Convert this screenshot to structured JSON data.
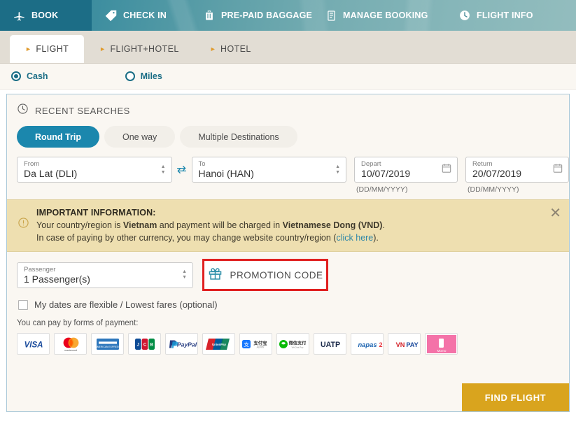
{
  "topnav": {
    "items": [
      {
        "label": "BOOK",
        "icon": "airplane-icon",
        "active": true
      },
      {
        "label": "CHECK IN",
        "icon": "boarding-pass-icon",
        "active": false
      },
      {
        "label": "PRE-PAID BAGGAGE",
        "icon": "suitcase-icon",
        "active": false
      },
      {
        "label": "MANAGE BOOKING",
        "icon": "document-icon",
        "active": false
      },
      {
        "label": "FLIGHT INFO",
        "icon": "clock-icon",
        "active": false
      }
    ]
  },
  "tabs": [
    {
      "label": "FLIGHT",
      "active": true
    },
    {
      "label": "FLIGHT+HOTEL",
      "active": false
    },
    {
      "label": "HOTEL",
      "active": false
    }
  ],
  "fare": {
    "options": [
      {
        "label": "Cash",
        "selected": true
      },
      {
        "label": "Miles",
        "selected": false
      }
    ]
  },
  "search": {
    "recent_searches_label": "RECENT SEARCHES",
    "trip_types": [
      {
        "label": "Round Trip",
        "active": true
      },
      {
        "label": "One way",
        "active": false
      },
      {
        "label": "Multiple Destinations",
        "active": false
      }
    ],
    "from": {
      "label": "From",
      "value": "Da Lat (DLI)"
    },
    "to": {
      "label": "To",
      "value": "Hanoi (HAN)"
    },
    "depart": {
      "label": "Depart",
      "value": "10/07/2019",
      "format": "(DD/MM/YYYY)"
    },
    "return": {
      "label": "Return",
      "value": "20/07/2019",
      "format": "(DD/MM/YYYY)"
    },
    "passenger": {
      "label": "Passenger",
      "value": "1 Passenger(s)"
    },
    "promotion_code_label": "PROMOTION CODE",
    "flexible_dates_label": "My dates are flexible / Lowest fares (optional)",
    "find_flight_label": "FIND FLIGHT"
  },
  "banner": {
    "title": "IMPORTANT INFORMATION:",
    "line1_a": "Your country/region is ",
    "line1_b": "Vietnam",
    "line1_c": " and payment will be charged in ",
    "line1_d": "Vietnamese Dong (VND)",
    "line1_e": ".",
    "line2_a": "In case of paying by other currency, you may change website country/region (",
    "line2_link": "click here",
    "line2_b": ").",
    "close_label": "✕"
  },
  "payment": {
    "title": "You can pay by forms of payment:",
    "methods": [
      {
        "name": "VISA"
      },
      {
        "name": "Mastercard"
      },
      {
        "name": "American Express"
      },
      {
        "name": "JCB"
      },
      {
        "name": "PayPal"
      },
      {
        "name": "UnionPay"
      },
      {
        "name": "Alipay"
      },
      {
        "name": "WeChat Pay"
      },
      {
        "name": "UATP"
      },
      {
        "name": "napas"
      },
      {
        "name": "VNPAY"
      },
      {
        "name": "Momo"
      }
    ]
  },
  "colors": {
    "accent_teal": "#1b87ad",
    "nav_active": "#1c6d86",
    "banner_bg": "#eedfb0",
    "promo_border": "#e02020",
    "find_button": "#d9a41e",
    "caret_orange": "#e09b2d"
  }
}
